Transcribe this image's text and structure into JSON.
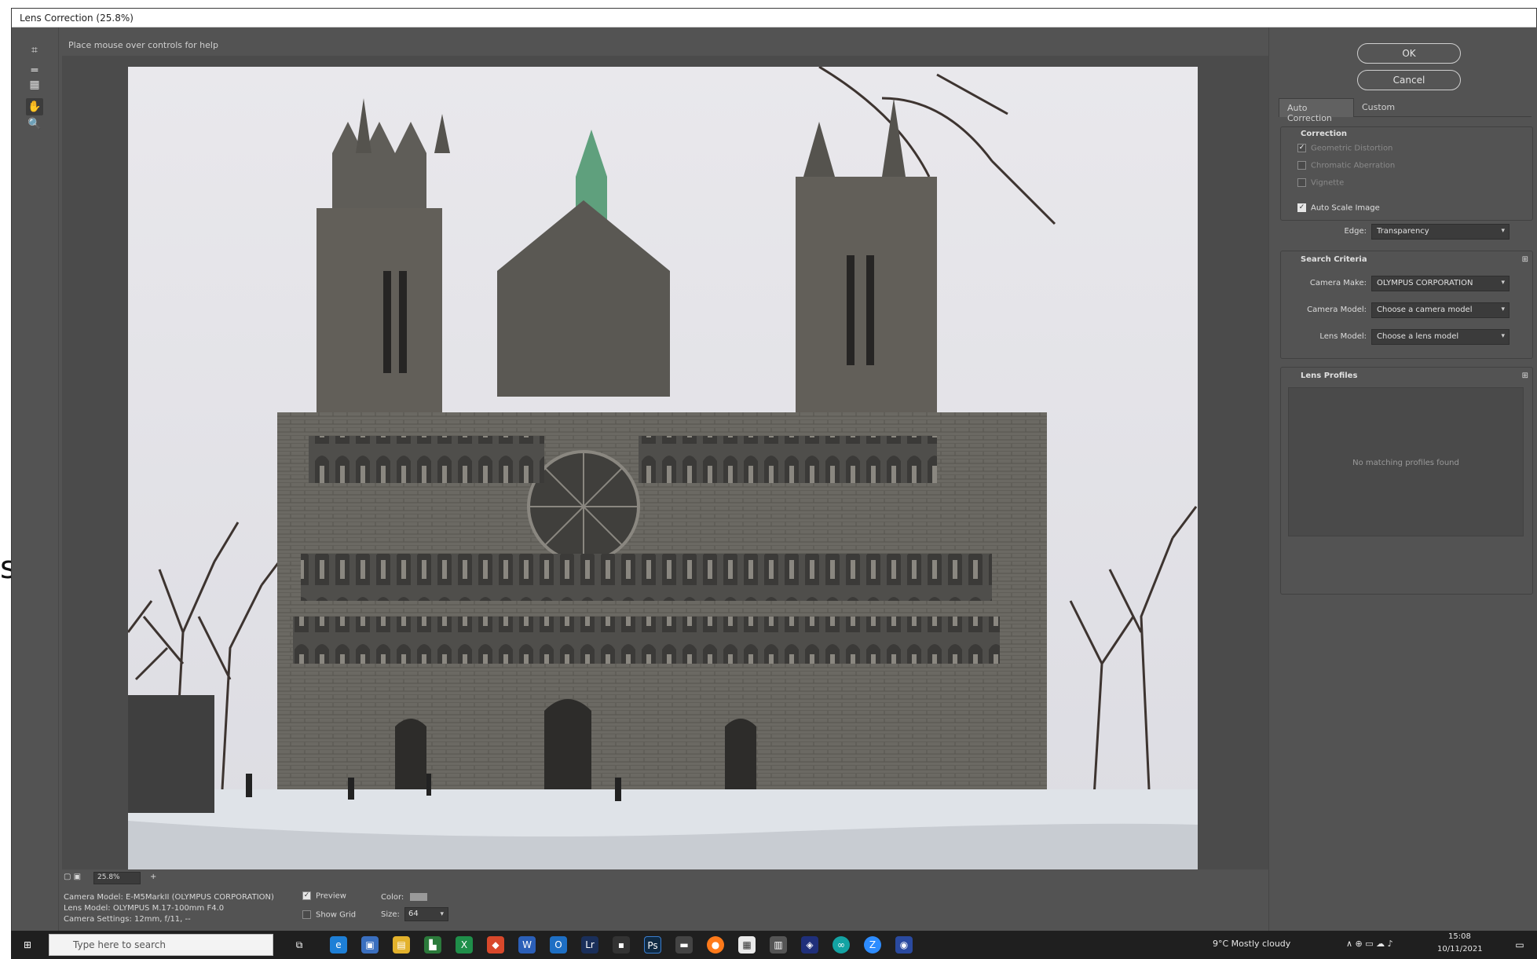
{
  "window": {
    "title": "Lens Correction (25.8%)"
  },
  "tools": {
    "hint": "Place mouse over controls for help",
    "icons": [
      "remove-distortion-tool",
      "straighten-tool",
      "move-grid-tool",
      "hand-tool",
      "zoom-tool"
    ]
  },
  "buttons": {
    "ok": "OK",
    "cancel": "Cancel"
  },
  "tabs": [
    {
      "label": "Auto Correction",
      "active": true
    },
    {
      "label": "Custom",
      "active": false
    }
  ],
  "correction": {
    "title": "Correction",
    "items": [
      {
        "label": "Geometric Distortion",
        "checked": true,
        "enabled": false
      },
      {
        "label": "Chromatic Aberration",
        "checked": false,
        "enabled": false
      },
      {
        "label": "Vignette",
        "checked": false,
        "enabled": false
      }
    ],
    "auto_scale": {
      "label": "Auto Scale Image",
      "checked": true
    },
    "edge": {
      "label": "Edge:",
      "value": "Transparency"
    }
  },
  "search_criteria": {
    "title": "Search Criteria",
    "make": {
      "label": "Camera Make:",
      "value": "OLYMPUS CORPORATION"
    },
    "model": {
      "label": "Camera Model:",
      "value": "Choose a camera model"
    },
    "lens": {
      "label": "Lens Model:",
      "value": "Choose a lens model"
    }
  },
  "lens_profiles": {
    "title": "Lens Profiles",
    "empty": "No matching profiles found"
  },
  "status": {
    "zoom": "25.8%",
    "camera_model": "Camera Model: E-M5MarkII (OLYMPUS CORPORATION)",
    "lens_model": "Lens Model: OLYMPUS M.17-100mm F4.0",
    "camera_settings": "Camera Settings: 12mm, f/11, --",
    "preview": "Preview",
    "show_grid": "Show Grid",
    "color_label": "Color:",
    "size_label": "Size:",
    "size_value": "64"
  },
  "taskbar": {
    "search_placeholder": "Type here to search",
    "weather": "9°C  Mostly cloudy",
    "time": "15:08",
    "date": "10/11/2021"
  },
  "colors": {
    "window_bg": "#535353",
    "sky": "#e7e6ea",
    "stone": "#5d5c58",
    "spire": "#5fa07d",
    "snow": "#dfe3e8"
  }
}
